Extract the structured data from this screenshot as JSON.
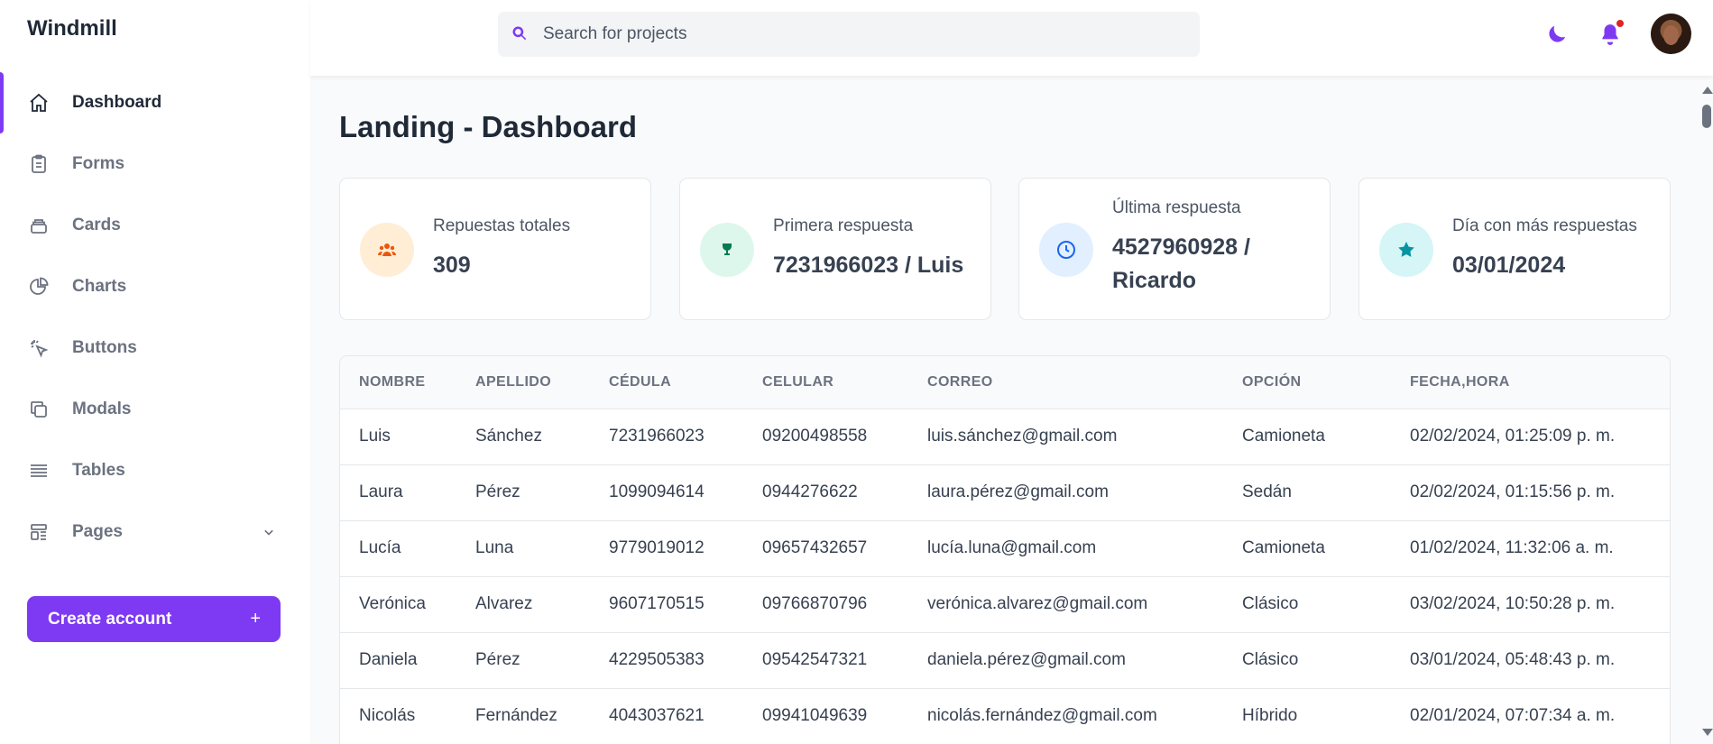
{
  "app": {
    "brand": "Windmill"
  },
  "sidebar": {
    "items": [
      {
        "label": "Dashboard",
        "icon": "home-icon",
        "active": true
      },
      {
        "label": "Forms",
        "icon": "clipboard-icon"
      },
      {
        "label": "Cards",
        "icon": "cards-icon"
      },
      {
        "label": "Charts",
        "icon": "pie-chart-icon"
      },
      {
        "label": "Buttons",
        "icon": "cursor-click-icon"
      },
      {
        "label": "Modals",
        "icon": "duplicate-icon"
      },
      {
        "label": "Tables",
        "icon": "list-icon"
      },
      {
        "label": "Pages",
        "icon": "template-icon"
      }
    ],
    "create_account": {
      "label": "Create account",
      "plus": "+"
    }
  },
  "header": {
    "search": {
      "placeholder": "Search for projects",
      "value": ""
    },
    "icons": [
      "moon-icon",
      "bell-icon",
      "avatar"
    ],
    "notification_color": "#e02424"
  },
  "main": {
    "title": "Landing - Dashboard",
    "cards": [
      {
        "label": "Repuestas totales",
        "value": "309",
        "icon": "users-icon",
        "icon_bg": "#ffedd5",
        "icon_color": "#ea580c"
      },
      {
        "label": "Primera respuesta",
        "value": "7231966023 / Luis",
        "icon": "trophy-icon",
        "icon_bg": "#def7ec",
        "icon_color": "#057a55"
      },
      {
        "label": "Última respuesta",
        "value": "4527960928 / Ricardo",
        "icon": "clock-icon",
        "icon_bg": "#e1effe",
        "icon_color": "#1c64f2"
      },
      {
        "label": "Día con más respuestas",
        "value": "03/01/2024",
        "icon": "star-icon",
        "icon_bg": "#d5f5f6",
        "icon_color": "#0694a2"
      }
    ],
    "table": {
      "columns": [
        "NOMBRE",
        "APELLIDO",
        "CÉDULA",
        "CELULAR",
        "CORREO",
        "OPCIÓN",
        "FECHA,HORA"
      ],
      "rows": [
        [
          "Luis",
          "Sánchez",
          "7231966023",
          "09200498558",
          "luis.sánchez@gmail.com",
          "Camioneta",
          "02/02/2024, 01:25:09 p. m."
        ],
        [
          "Laura",
          "Pérez",
          "1099094614",
          "0944276622",
          "laura.pérez@gmail.com",
          "Sedán",
          "02/02/2024, 01:15:56 p. m."
        ],
        [
          "Lucía",
          "Luna",
          "9779019012",
          "09657432657",
          "lucía.luna@gmail.com",
          "Camioneta",
          "01/02/2024, 11:32:06 a. m."
        ],
        [
          "Verónica",
          "Alvarez",
          "9607170515",
          "09766870796",
          "verónica.alvarez@gmail.com",
          "Clásico",
          "03/02/2024, 10:50:28 p. m."
        ],
        [
          "Daniela",
          "Pérez",
          "4229505383",
          "09542547321",
          "daniela.pérez@gmail.com",
          "Clásico",
          "03/01/2024, 05:48:43 p. m."
        ],
        [
          "Nicolás",
          "Fernández",
          "4043037621",
          "09941049639",
          "nicolás.fernández@gmail.com",
          "Híbrido",
          "02/01/2024, 07:07:34 a. m."
        ]
      ]
    }
  },
  "colors": {
    "accent": "#7e3af2"
  }
}
